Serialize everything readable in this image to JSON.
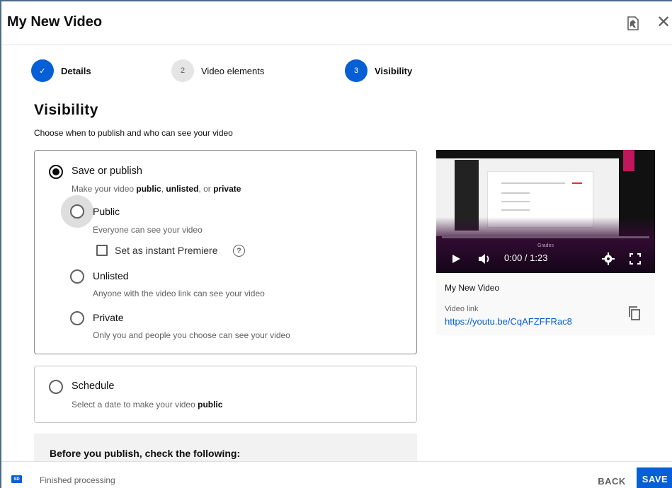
{
  "dialog": {
    "title": "My New Video",
    "icons": {
      "feedback": "feedback-icon",
      "close": "close-icon"
    },
    "close_glyph": "✕"
  },
  "stepper": {
    "steps": [
      {
        "number": "✓",
        "label": "Details",
        "state": "done"
      },
      {
        "number": "2",
        "label": "Video elements",
        "state": "todo"
      },
      {
        "number": "3",
        "label": "Visibility",
        "state": "active"
      }
    ]
  },
  "visibility": {
    "title": "Visibility",
    "subtitle": "Choose when to publish and who can see your video",
    "save_or_publish": {
      "label": "Save or publish",
      "selected": true,
      "desc_prefix": "Make your video ",
      "desc_public": "public",
      "desc_sep1": ", ",
      "desc_unlisted": "unlisted",
      "desc_sep2": ", or ",
      "desc_private": "private",
      "options": [
        {
          "label": "Public",
          "desc": "Everyone can see your video"
        },
        {
          "label": "Unlisted",
          "desc": "Anyone with the video link can see your video"
        },
        {
          "label": "Private",
          "desc": "Only you and people you choose can see your video"
        }
      ],
      "premiere": {
        "label": "Set as instant Premiere",
        "checked": false,
        "help_glyph": "?"
      }
    },
    "schedule": {
      "label": "Schedule",
      "desc_prefix": "Select a date to make your video ",
      "desc_bold": "public"
    },
    "checklist_title": "Before you publish, check the following:"
  },
  "preview": {
    "player": {
      "time": "0:00 / 1:23",
      "overlay_text": "Grades",
      "icons": [
        "play-icon",
        "volume-icon",
        "settings-icon",
        "fullscreen-icon"
      ]
    },
    "video_title": "My New Video",
    "link_label": "Video link",
    "link": "https://youtu.be/CqAFZFFRac8"
  },
  "footer": {
    "badge": "SD",
    "status": "Finished processing",
    "back_label": "BACK",
    "save_label": "SAVE"
  },
  "colors": {
    "accent": "#065fd4",
    "text_primary": "#0d0d0d",
    "text_secondary": "#606060",
    "brand_pink": "#c0175d"
  }
}
